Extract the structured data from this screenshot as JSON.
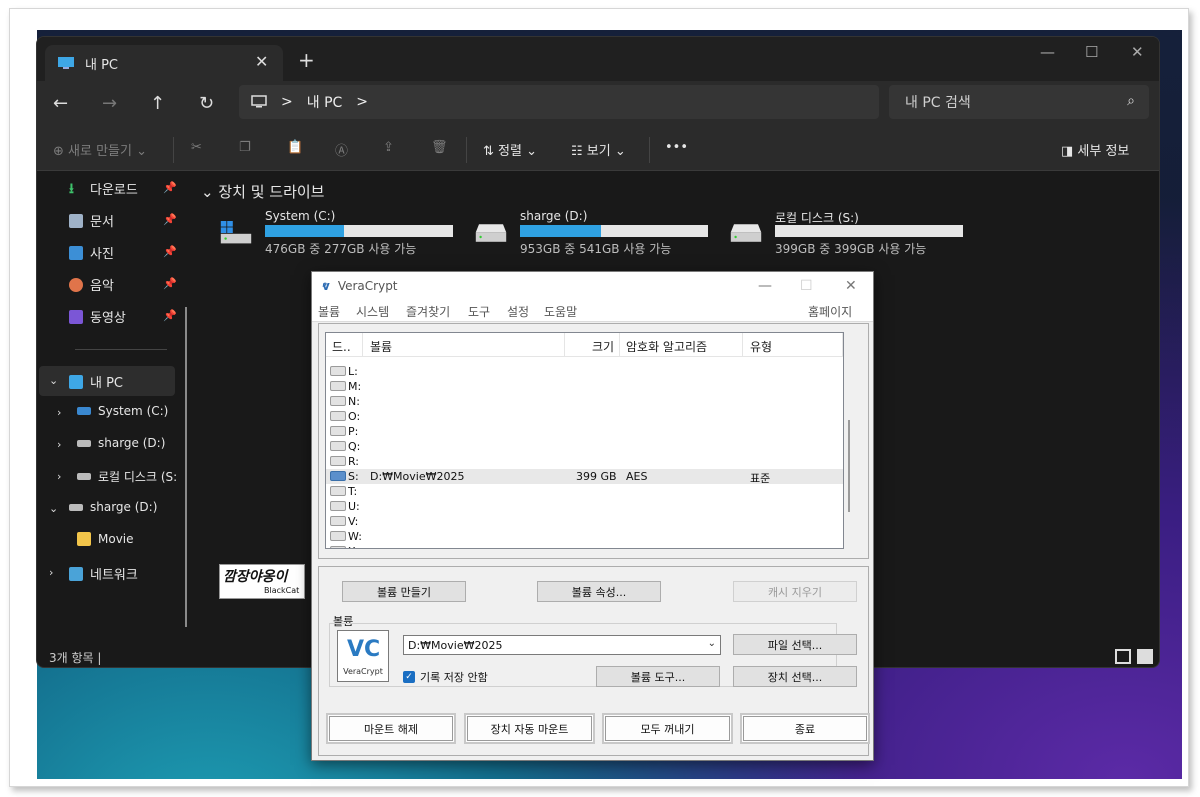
{
  "explorer": {
    "tab_title": "내 PC",
    "new_tab": "+",
    "address": {
      "crumb": "내 PC",
      "sep": ">"
    },
    "search_placeholder": "내 PC 검색",
    "commands": {
      "new": "새로 만들기",
      "sort": "정렬",
      "view": "보기",
      "more": "•••",
      "details": "세부 정보"
    },
    "sidebar": {
      "quick": [
        {
          "label": "다운로드",
          "icon": "download-icon"
        },
        {
          "label": "문서",
          "icon": "document-icon"
        },
        {
          "label": "사진",
          "icon": "pictures-icon"
        },
        {
          "label": "음악",
          "icon": "music-icon"
        },
        {
          "label": "동영상",
          "icon": "video-icon"
        }
      ],
      "this_pc": "내 PC",
      "drives": [
        "System (C:)",
        "sharge (D:)",
        "로컬 디스크 (S:"
      ],
      "sharge": "sharge (D:)",
      "movie": "Movie",
      "network": "네트워크"
    },
    "group_header": "장치 및 드라이브",
    "drives": [
      {
        "name": "System (C:)",
        "free_text": "476GB 중 277GB 사용 가능",
        "used_fraction": 0.42
      },
      {
        "name": "sharge (D:)",
        "free_text": "953GB 중 541GB 사용 가능",
        "used_fraction": 0.43
      },
      {
        "name": "로컬 디스크 (S:)",
        "free_text": "399GB 중 399GB 사용 가능",
        "used_fraction": 0.0
      }
    ],
    "status": "3개 항목  |",
    "colors": {
      "accent": "#2fa1e2",
      "bg": "#191919"
    }
  },
  "watermark": {
    "text": "깜장야옹이",
    "sub": "BlackCat"
  },
  "veracrypt": {
    "title": "VeraCrypt",
    "menu": [
      "볼륨",
      "시스템",
      "즐겨찾기",
      "도구",
      "설정",
      "도움말"
    ],
    "homepage": "홈페이지",
    "columns": [
      "드..",
      "볼륨",
      "크기",
      "암호화 알고리즘",
      "유형"
    ],
    "rows": [
      {
        "letter": "L:"
      },
      {
        "letter": "M:"
      },
      {
        "letter": "N:"
      },
      {
        "letter": "O:"
      },
      {
        "letter": "P:"
      },
      {
        "letter": "Q:"
      },
      {
        "letter": "R:"
      },
      {
        "letter": "S:",
        "volume": "D:₩Movie₩2025",
        "size": "399 GB",
        "algo": "AES",
        "type": "표준"
      },
      {
        "letter": "T:"
      },
      {
        "letter": "U:"
      },
      {
        "letter": "V:"
      },
      {
        "letter": "W:"
      },
      {
        "letter": "X:"
      }
    ],
    "buttons": {
      "create": "볼륨 만들기",
      "props": "볼륨 속성...",
      "wipe": "캐시 지우기",
      "select_file": "파일 선택...",
      "tools": "볼륨 도구...",
      "select_device": "장치 선택...",
      "dismount": "마운트 해제",
      "automount": "장치 자동 마운트",
      "dismount_all": "모두 꺼내기",
      "exit": "종료"
    },
    "volume_group": "볼륨",
    "volume_path": "D:₩Movie₩2025",
    "never_save": "기록 저장 안함",
    "logo_mark": "VC",
    "logo_name": "VeraCrypt"
  }
}
